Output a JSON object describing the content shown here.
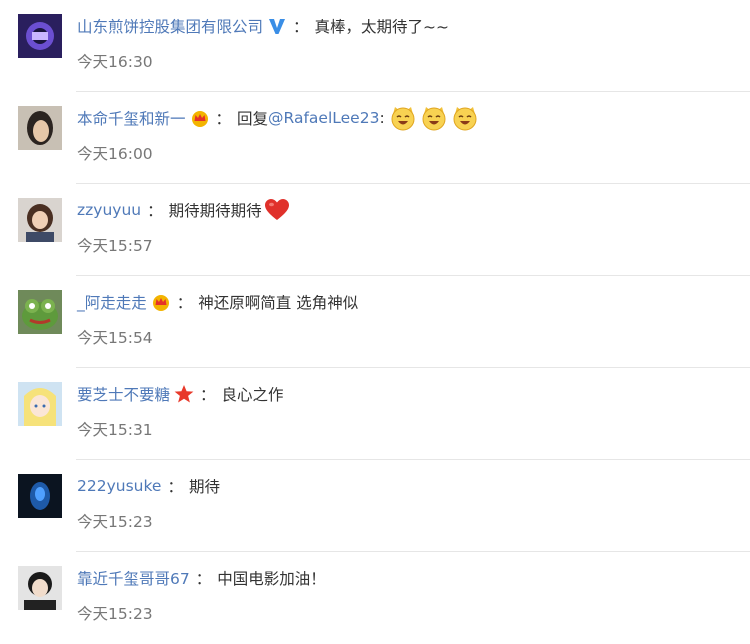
{
  "comments": [
    {
      "username": "山东煎饼控股集团有限公司",
      "badge_icon": "verified-v-icon",
      "separator": "：",
      "text": "真棒，太期待了~~",
      "time": "今天16:30"
    },
    {
      "username": "本命千玺和新一",
      "badge_icon": "crown-icon",
      "separator": "：",
      "text": "回复",
      "mention": "@RafaelLee23",
      "after_mention": ":",
      "emoji_icons": [
        "laughing-cat-emoji",
        "laughing-cat-emoji",
        "laughing-cat-emoji"
      ],
      "time": "今天16:00"
    },
    {
      "username": "zzyuyuu",
      "separator": "：",
      "text": "期待期待期待",
      "emoji_icons": [
        "red-heart-emoji"
      ],
      "time": "今天15:57"
    },
    {
      "username": "_阿走走走",
      "badge_icon": "crown-icon",
      "separator": "：",
      "text": "神还原啊简直 选角神似",
      "time": "今天15:54"
    },
    {
      "username": "要芝士不要糖",
      "badge_icon": "red-star-icon",
      "separator": "：",
      "text": "良心之作",
      "time": "今天15:31"
    },
    {
      "username": "222yusuke",
      "separator": "：",
      "text": "期待",
      "time": "今天15:23"
    },
    {
      "username": "靠近千玺哥哥67",
      "separator": "：",
      "text": "中国电影加油！",
      "time": "今天15:23"
    }
  ],
  "colors": {
    "username": "#4f79b8",
    "text": "#333333",
    "time": "#777777",
    "divider": "#e6e6e6",
    "verified": "#3a8ee6",
    "crown": "#f0a800",
    "star": "#e8392a",
    "heart": "#e0312b"
  }
}
